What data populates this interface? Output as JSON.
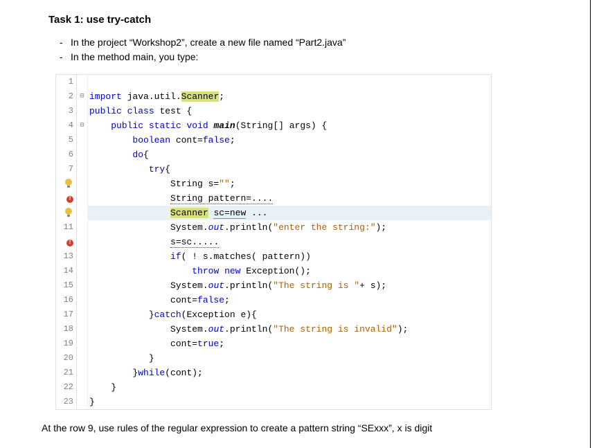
{
  "heading": "Task 1: use try-catch",
  "bullets": [
    "In the project “Workshop2”, create a new file named “Part2.java”",
    "In the method main, you type:"
  ],
  "code": {
    "lines": [
      {
        "num": "1",
        "icon": "",
        "fold": "",
        "html": ""
      },
      {
        "num": "2",
        "icon": "",
        "fold": "⊟",
        "html": "<span class='kw'>import</span> java.util.<span class='hl-yellow'>Scanner</span>;"
      },
      {
        "num": "3",
        "icon": "",
        "fold": "",
        "html": "<span class='kw'>public</span> <span class='kw'>class</span> <span>test</span> {"
      },
      {
        "num": "4",
        "icon": "",
        "fold": "⊟",
        "html": "    <span class='kw'>public</span> <span class='kw'>static</span> <span class='kw'>void</span> <span style='font-weight:bold;font-style:italic'>main</span>(String[] args) {"
      },
      {
        "num": "5",
        "icon": "",
        "fold": "",
        "html": "        <span class='kw'>boolean</span> cont=<span class='kw'>false</span>;"
      },
      {
        "num": "6",
        "icon": "",
        "fold": "",
        "html": "        <span class='kw'>do</span>{"
      },
      {
        "num": "7",
        "icon": "",
        "fold": "",
        "html": "           <span class='kw'>try</span>{"
      },
      {
        "num": "",
        "icon": "bulb",
        "fold": "",
        "html": "               String s=<span class='str'>\"\"</span>;"
      },
      {
        "num": "",
        "icon": "err",
        "fold": "",
        "html": "               <span class='underline-red'>String pattern=....</span>"
      },
      {
        "num": "",
        "icon": "bulb",
        "fold": "",
        "hl": true,
        "html": "               <span class='hl-yellow'>Scanner</span> <span class='underline-green'>sc=new</span> ..."
      },
      {
        "num": "11",
        "icon": "",
        "fold": "",
        "html": "               System.<span class='ital'>out</span>.println(<span class='str'>\"enter the string:\"</span>);"
      },
      {
        "num": "",
        "icon": "err",
        "fold": "",
        "html": "               <span class='underline-red'>s=sc.....</span>"
      },
      {
        "num": "13",
        "icon": "",
        "fold": "",
        "html": "               <span class='kw'>if</span>( ! s.matches( pattern))"
      },
      {
        "num": "14",
        "icon": "",
        "fold": "",
        "html": "                   <span class='kw'>throw</span> <span class='kw'>new</span> Exception();"
      },
      {
        "num": "15",
        "icon": "",
        "fold": "",
        "html": "               System.<span class='ital'>out</span>.println(<span class='str'>\"The string is \"</span>+ s);"
      },
      {
        "num": "16",
        "icon": "",
        "fold": "",
        "html": "               cont=<span class='kw'>false</span>;"
      },
      {
        "num": "17",
        "icon": "",
        "fold": "",
        "html": "           }<span class='kw'>catch</span>(Exception e){"
      },
      {
        "num": "18",
        "icon": "",
        "fold": "",
        "html": "               System.<span class='ital'>out</span>.println(<span class='str'>\"The string is invalid\"</span>);"
      },
      {
        "num": "19",
        "icon": "",
        "fold": "",
        "html": "               cont=<span class='kw'>true</span>;"
      },
      {
        "num": "20",
        "icon": "",
        "fold": "",
        "html": "           }"
      },
      {
        "num": "21",
        "icon": "",
        "fold": "",
        "html": "        }<span class='kw'>while</span>(cont);"
      },
      {
        "num": "22",
        "icon": "",
        "fold": "",
        "html": "    }"
      },
      {
        "num": "23",
        "icon": "",
        "fold": "",
        "html": "}"
      }
    ]
  },
  "footer": "At the row 9, use rules of the regular expression to create a pattern string “SExxx”, x is digit"
}
